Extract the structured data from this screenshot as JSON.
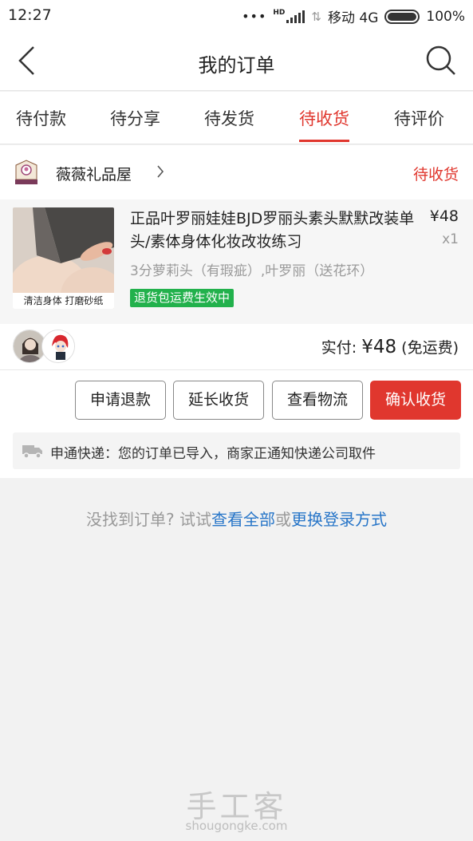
{
  "status_bar": {
    "time": "12:27",
    "hd": "HD",
    "carrier": "移动 4G",
    "battery": "100%"
  },
  "nav": {
    "title": "我的订单",
    "back_icon": "back-arrow-icon",
    "search_icon": "search-icon"
  },
  "tabs": [
    {
      "label": "待付款",
      "active": false
    },
    {
      "label": "待分享",
      "active": false
    },
    {
      "label": "待发货",
      "active": false
    },
    {
      "label": "待收货",
      "active": true
    },
    {
      "label": "待评价",
      "active": false
    }
  ],
  "order": {
    "shop_name": "薇薇礼品屋",
    "status": "待收货",
    "product": {
      "title": "正品叶罗丽娃娃BJD罗丽头素头默默改装单头/素体身体化妆改妆练习",
      "price": "¥48",
      "quantity": "x1",
      "variant": "3分萝莉头（有瑕疵）,叶罗丽（送花环）",
      "badge": "退货包运费生效中",
      "image_caption": "清洁身体 打磨砂纸"
    },
    "paid_label": "实付:",
    "paid_amount": "¥48",
    "shipping_note": "(免运费)",
    "buttons": {
      "refund": "申请退款",
      "extend": "延长收货",
      "logistics": "查看物流",
      "confirm": "确认收货"
    },
    "logistics_message": "申通快递：您的订单已导入，商家正通知快递公司取件"
  },
  "not_found": {
    "prefix": "没找到订单? 试试",
    "view_all": "查看全部",
    "or": "或",
    "switch_login": "更换登录方式"
  },
  "watermark": {
    "text": "手工客",
    "url": "shougongke.com"
  },
  "colors": {
    "accent": "#e0372e",
    "link": "#2775c8",
    "badge": "#22b14c"
  }
}
